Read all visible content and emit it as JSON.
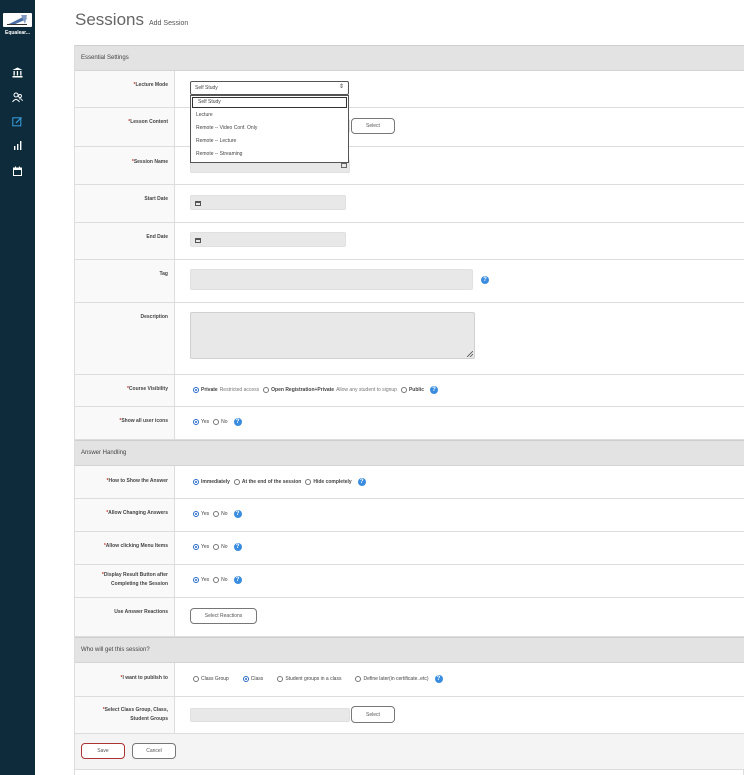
{
  "sidebar": {
    "logo_text": "Equalear...",
    "icons": [
      "bank-icon",
      "users-icon",
      "edit-icon",
      "chart-icon",
      "calendar-icon"
    ]
  },
  "page": {
    "title": "Sessions",
    "subtitle": "Add Session"
  },
  "sections": {
    "essential": "Essential Settings",
    "answer": "Answer Handling",
    "who": "Who will get this session?"
  },
  "fields": {
    "lecture_mode": {
      "label": "Lecture Mode",
      "value": "Self Study",
      "options": [
        "Self Study",
        "Lecture",
        "Remote -- Video Conf. Only",
        "Remote -- Lecture",
        "Remote -- Streaming"
      ]
    },
    "lesson_content": {
      "label": "Lesson Content",
      "button": "Select"
    },
    "session_name": {
      "label": "Session Name"
    },
    "start_date": {
      "label": "Start Date"
    },
    "end_date": {
      "label": "End Date"
    },
    "tag": {
      "label": "Tag"
    },
    "description": {
      "label": "Description"
    },
    "course_visibility": {
      "label": "Course Visibility",
      "options": [
        {
          "name": "Private",
          "desc": "Restricted access"
        },
        {
          "name": "Open Registration+Private",
          "desc": "Allow any student to signup"
        },
        {
          "name": "Public",
          "desc": ""
        }
      ]
    },
    "show_icons": {
      "label": "Show all user icons",
      "yes": "Yes",
      "no": "No"
    },
    "how_show": {
      "label": "How to Show the Answer",
      "options": [
        "Immediately",
        "At the end of the session",
        "Hide completely"
      ]
    },
    "allow_changing": {
      "label": "Allow Changing Answers",
      "yes": "Yes",
      "no": "No"
    },
    "allow_menu": {
      "label": "Allow clicking Menu Items",
      "yes": "Yes",
      "no": "No"
    },
    "display_result": {
      "label_1": "Display Result Button after",
      "label_2": "Completing the Session",
      "yes": "Yes",
      "no": "No"
    },
    "reactions": {
      "label": "Use Answer Reactions",
      "button": "Select Reactions"
    },
    "publish": {
      "label": "I want to publish to",
      "options": [
        "Class Group",
        "Class",
        "Student groups in a class",
        "Define later(in certificate..etc)"
      ]
    },
    "select_groups": {
      "label_1": "Select Class Group, Class,",
      "label_2": "Student Groups",
      "button": "Select"
    }
  },
  "actions": {
    "save": "Save",
    "cancel": "Cancel"
  },
  "help_glyph": "?",
  "required_mark": "*",
  "colors": {
    "sidebar": "#0d2b3a",
    "accent": "#3a8dde",
    "save_border": "#a33"
  }
}
